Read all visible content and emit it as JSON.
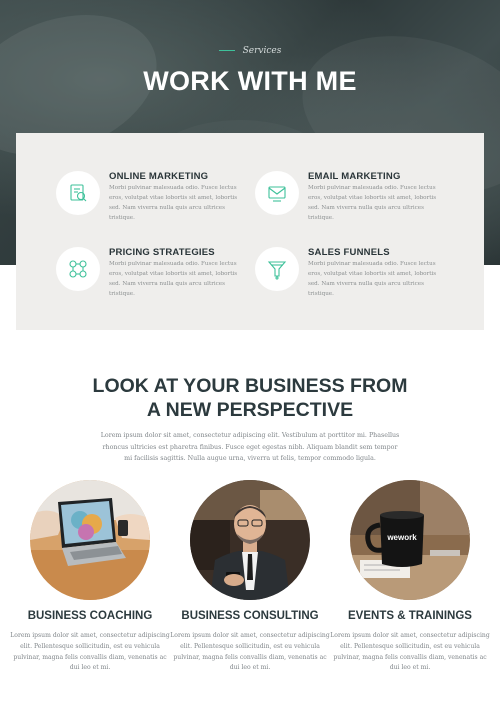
{
  "hero": {
    "eyebrow": "Services",
    "title": "WORK WITH ME"
  },
  "services": [
    {
      "title": "ONLINE MARKETING",
      "text": "Morbi pulvinar malesuada odio. Fusce lectus eros, volutpat vitae lobortis sit amet, lobortis sed. Nam viverra nulla quis arcu ultrices tristique.",
      "icon": "online-marketing-icon"
    },
    {
      "title": "EMAIL MARKETING",
      "text": "Morbi pulvinar malesuada odio. Fusce lectus eros, volutpat vitae lobortis sit amet, lobortis sed. Nam viverra nulla quis arcu ultrices tristique.",
      "icon": "email-marketing-icon"
    },
    {
      "title": "PRICING STRATEGIES",
      "text": "Morbi pulvinar malesuada odio. Fusce lectus eros, volutpat vitae lobortis sit amet, lobortis sed. Nam viverra nulla quis arcu ultrices tristique.",
      "icon": "pricing-strategies-icon"
    },
    {
      "title": "SALES FUNNELS",
      "text": "Morbi pulvinar malesuada odio. Fusce lectus eros, volutpat vitae lobortis sit amet, lobortis sed. Nam viverra nulla quis arcu ultrices tristique.",
      "icon": "sales-funnels-icon"
    }
  ],
  "perspective": {
    "title_line1": "LOOK AT YOUR BUSINESS FROM",
    "title_line2": "A NEW PERSPECTIVE",
    "text": "Lorem ipsum dolor sit amet, consectetur adipiscing elit. Vestibulum at porttitor mi. Phasellus rhoncus ultricies est pharetra finibus. Fusce eget egestas nibh. Aliquam blandit sem tempor mi facilisis sagittis. Nulla augue urna, viverra ut felis, tempor commodo ligula."
  },
  "features": [
    {
      "title": "BUSINESS COACHING",
      "text": "Lorem ipsum dolor sit amet, consectetur adipiscing elit. Pellentesque sollicitudin, est eu vehicula pulvinar, magna felis convallis diam, venenatis ac dui leo et mi."
    },
    {
      "title": "BUSINESS CONSULTING",
      "text": "Lorem ipsum dolor sit amet, consectetur adipiscing elit. Pellentesque sollicitudin, est eu vehicula pulvinar, magna felis convallis diam, venenatis ac dui leo et mi."
    },
    {
      "title": "EVENTS & TRAININGS",
      "text": "Lorem ipsum dolor sit amet, consectetur adipiscing elit. Pellentesque sollicitudin, est eu vehicula pulvinar, magna felis convallis diam, venenatis ac dui leo et mi.",
      "mug_text": "wework"
    }
  ],
  "colors": {
    "accent": "#3ec19a",
    "heading": "#2c3a3e",
    "hero_bg": "#2f3b3c",
    "card_bg": "#efeeec"
  }
}
